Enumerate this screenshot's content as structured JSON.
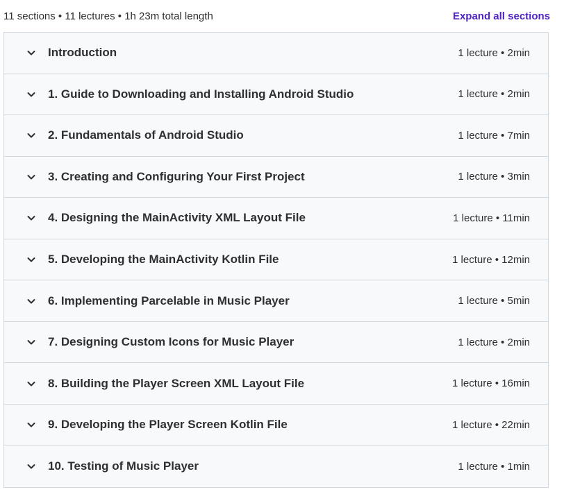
{
  "header": {
    "summary": "11 sections • 11 lectures • 1h 23m total length",
    "expand_label": "Expand all sections"
  },
  "colors": {
    "accent": "#5022c3",
    "row_background": "#f7f9fa",
    "border": "#d1d7dc",
    "text": "#2d2f31"
  },
  "icons": {
    "row_toggle": "chevron-down-icon"
  },
  "sections": [
    {
      "title": "Introduction",
      "meta": "1 lecture • 2min"
    },
    {
      "title": "1. Guide to Downloading and Installing Android Studio",
      "meta": "1 lecture • 2min"
    },
    {
      "title": "2. Fundamentals of Android Studio",
      "meta": "1 lecture • 7min"
    },
    {
      "title": "3. Creating and Configuring Your First Project",
      "meta": "1 lecture • 3min"
    },
    {
      "title": "4. Designing the MainActivity XML Layout File",
      "meta": "1 lecture • 11min"
    },
    {
      "title": "5. Developing the MainActivity Kotlin File",
      "meta": "1 lecture • 12min"
    },
    {
      "title": "6. Implementing Parcelable in Music Player",
      "meta": "1 lecture • 5min"
    },
    {
      "title": "7. Designing Custom Icons for Music Player",
      "meta": "1 lecture • 2min"
    },
    {
      "title": "8. Building the Player Screen XML Layout File",
      "meta": "1 lecture • 16min"
    },
    {
      "title": "9. Developing the Player Screen Kotlin File",
      "meta": "1 lecture • 22min"
    },
    {
      "title": "10. Testing of Music Player",
      "meta": "1 lecture • 1min"
    }
  ]
}
